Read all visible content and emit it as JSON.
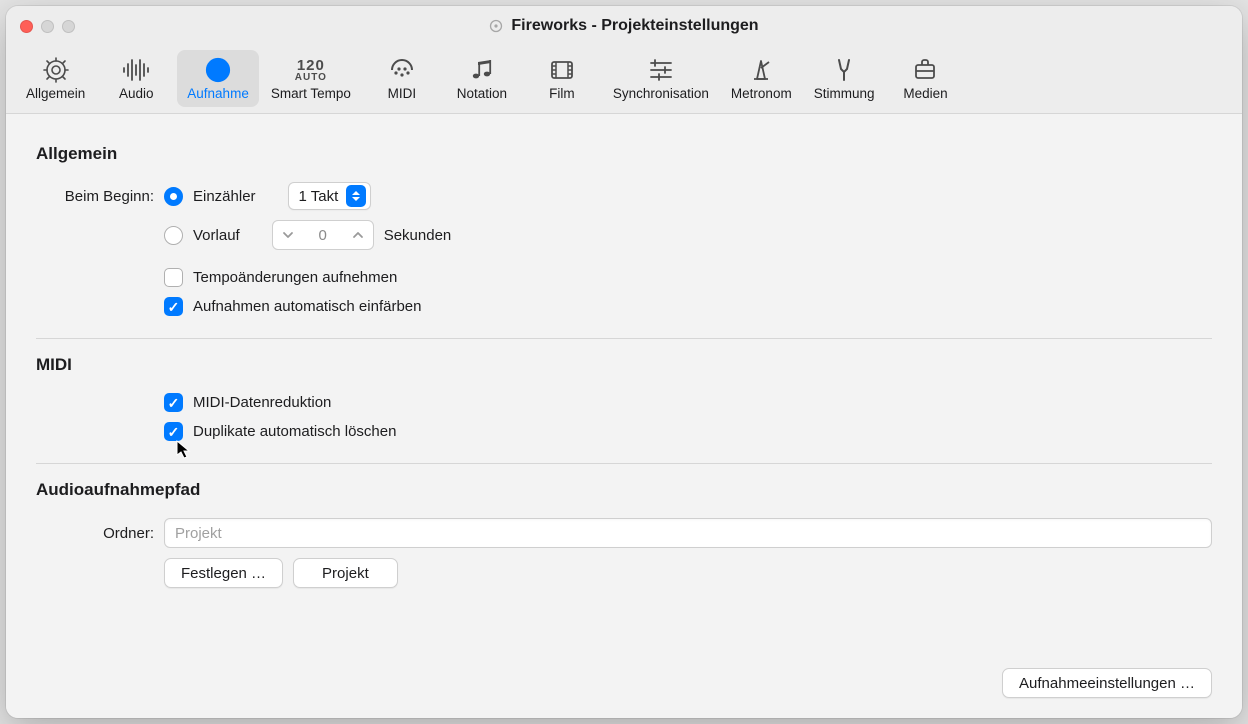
{
  "window": {
    "title": "Fireworks - Projekteinstellungen"
  },
  "toolbar": {
    "tabs": [
      {
        "id": "general",
        "label": "Allgemein"
      },
      {
        "id": "audio",
        "label": "Audio"
      },
      {
        "id": "recording",
        "label": "Aufnahme",
        "selected": true
      },
      {
        "id": "smart-tempo",
        "label": "Smart Tempo"
      },
      {
        "id": "midi",
        "label": "MIDI"
      },
      {
        "id": "notation",
        "label": "Notation"
      },
      {
        "id": "film",
        "label": "Film"
      },
      {
        "id": "sync",
        "label": "Synchronisation"
      },
      {
        "id": "metronome",
        "label": "Metronom"
      },
      {
        "id": "tuning",
        "label": "Stimmung"
      },
      {
        "id": "media",
        "label": "Medien"
      }
    ]
  },
  "sections": {
    "general": {
      "heading": "Allgemein",
      "start_label": "Beim Beginn:",
      "countin_label": "Einzähler",
      "countin_value": "1 Takt",
      "preroll_label": "Vorlauf",
      "preroll_value": "0",
      "preroll_unit": "Sekunden",
      "record_tempo_changes_label": "Tempoänderungen aufnehmen",
      "auto_color_takes_label": "Aufnahmen automatisch einfärben"
    },
    "midi": {
      "heading": "MIDI",
      "data_reduction_label": "MIDI-Datenreduktion",
      "auto_delete_duplicates_label": "Duplikate automatisch löschen"
    },
    "path": {
      "heading": "Audioaufnahmepfad",
      "folder_label": "Ordner:",
      "folder_value": "Projekt",
      "set_button": "Festlegen …",
      "project_button": "Projekt"
    }
  },
  "footer": {
    "recording_settings_button": "Aufnahmeeinstellungen …"
  }
}
